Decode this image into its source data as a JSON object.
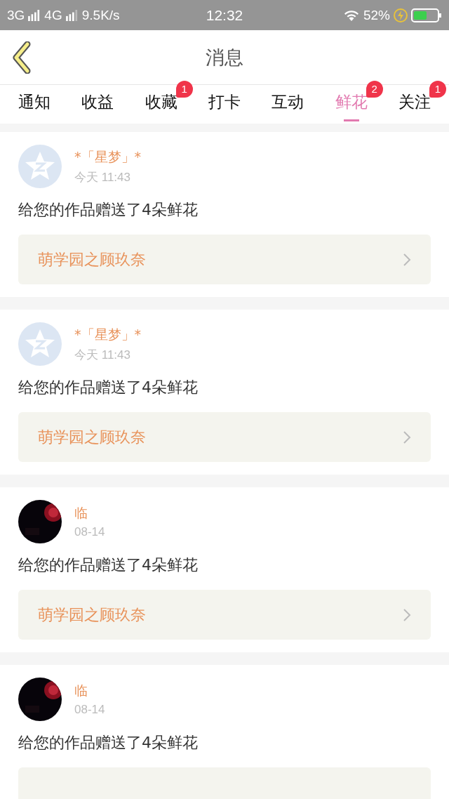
{
  "status_bar": {
    "network_1": "3G",
    "network_2": "4G",
    "speed": "9.5K/s",
    "time": "12:32",
    "battery": "52%"
  },
  "header": {
    "title": "消息"
  },
  "tabs": [
    {
      "label": "通知",
      "selected": false
    },
    {
      "label": "收益",
      "selected": false
    },
    {
      "label": "收藏",
      "selected": false,
      "badge": "1"
    },
    {
      "label": "打卡",
      "selected": false
    },
    {
      "label": "互动",
      "selected": false
    },
    {
      "label": "鲜花",
      "selected": true,
      "badge": "2"
    },
    {
      "label": "关注",
      "selected": false,
      "badge": "1"
    }
  ],
  "messages": [
    {
      "avatar": {
        "kind": "default"
      },
      "name": "*「星梦」*",
      "time": "今天 11:43",
      "text": "给您的作品赠送了4朵鲜花",
      "link": "萌学园之顾玖奈"
    },
    {
      "avatar": {
        "kind": "default"
      },
      "name": "*「星梦」*",
      "time": "今天 11:43",
      "text": "给您的作品赠送了4朵鲜花",
      "link": "萌学园之顾玖奈"
    },
    {
      "name": "临",
      "time": "08-14",
      "text": "给您的作品赠送了4朵鲜花",
      "link": "萌学园之顾玖奈"
    },
    {
      "name": "临",
      "time": "08-14",
      "text": "给您的作品赠送了4朵鲜花"
    }
  ]
}
